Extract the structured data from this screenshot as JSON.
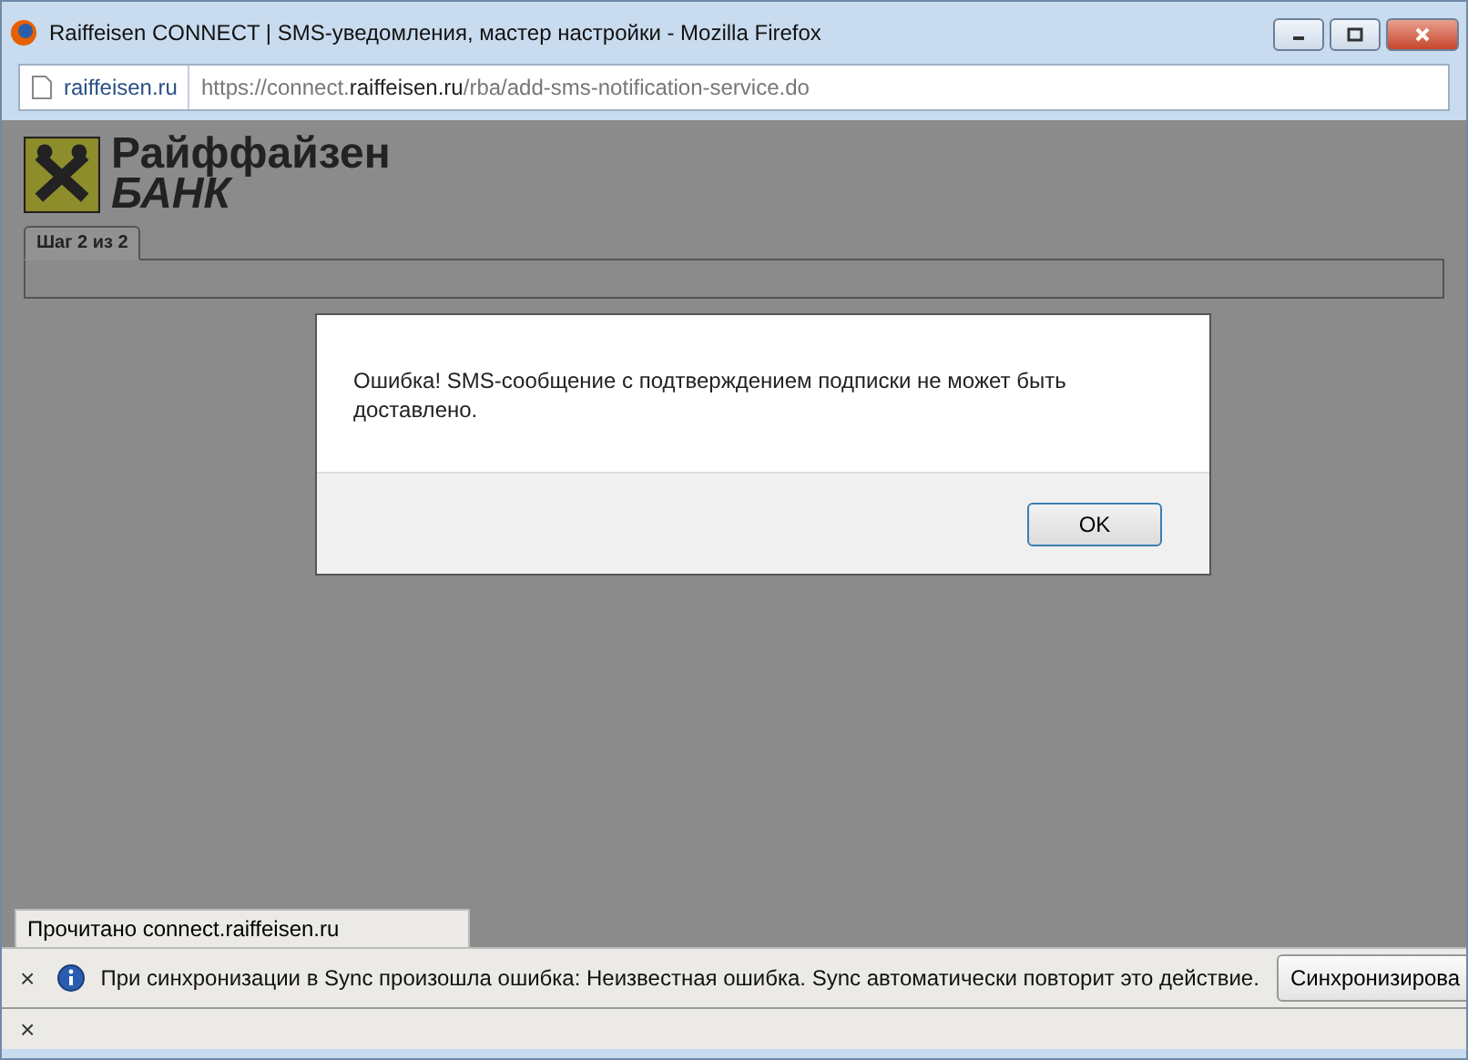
{
  "window": {
    "title": "Raiffeisen CONNECT | SMS-уведомления, мастер настройки - Mozilla Firefox"
  },
  "address_bar": {
    "site": "raiffeisen.ru",
    "url": "https://connect.**raiffeisen.ru**/rba/add-sms-notification-service.do"
  },
  "page": {
    "logo_line_1": "Райффайзен",
    "logo_line_2": "БАНК",
    "tabs": [
      {
        "label": "Шаг 2 из 2",
        "selected": true
      }
    ]
  },
  "dialog": {
    "message": "Ошибка! SMS-сообщение с подтверждением подписки не может быть доставлено.",
    "button": "OK"
  },
  "status_text": "Прочитано connect.raiffeisen.ru",
  "notification": {
    "close": "×",
    "message": "При синхронизации в Sync произошла ошибка: Неизвестная ошибка. Sync автоматически повторит это действие.",
    "button": "Синхронизирова"
  },
  "bottom_bar": {
    "close": "×"
  }
}
